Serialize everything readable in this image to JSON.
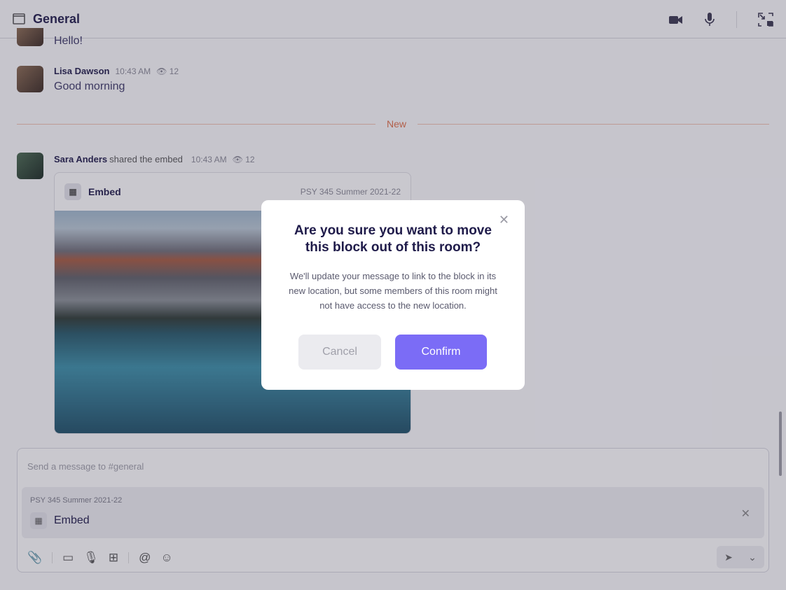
{
  "header": {
    "title": "General",
    "icons": [
      "window-icon",
      "video-icon",
      "microphone-icon",
      "picture-in-picture-icon"
    ]
  },
  "messages": [
    {
      "text": "Hello!"
    },
    {
      "name": "Lisa Dawson",
      "time": "10:43 AM",
      "views": "12",
      "text": "Good morning"
    },
    {
      "name": "Sara Anders",
      "action": "shared the embed",
      "time": "10:43 AM",
      "views": "12"
    }
  ],
  "divider": {
    "label": "New"
  },
  "embed": {
    "title": "Embed",
    "course": "PSY 345 Summer 2021-22"
  },
  "composer": {
    "placeholder": "Send a message to #general",
    "attachment": {
      "course": "PSY 345 Summer 2021-22",
      "title": "Embed"
    }
  },
  "modal": {
    "title": "Are you sure you want to move this block out of this room?",
    "body": "We'll update your message to link to the block in its new location, but some members of this room might not have access to the new location.",
    "cancel": "Cancel",
    "confirm": "Confirm"
  },
  "colors": {
    "accent": "#7b6cf6",
    "new_divider": "#e0704a"
  }
}
